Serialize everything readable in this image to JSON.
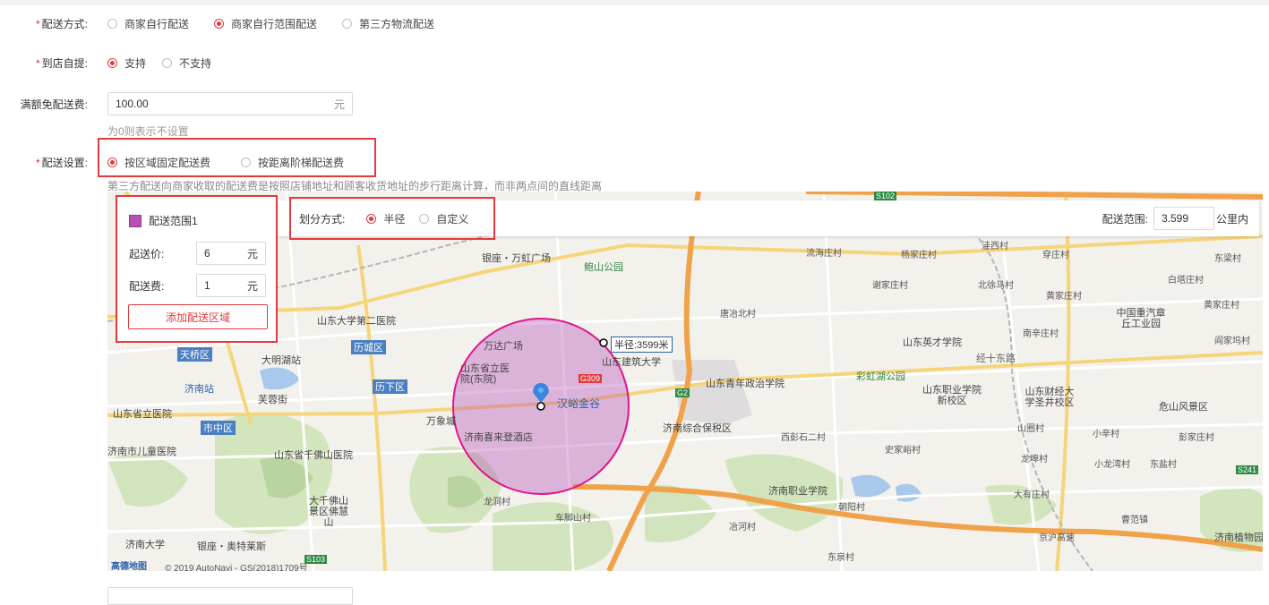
{
  "form": {
    "delivery_method": {
      "label": "配送方式:",
      "options": [
        "商家自行配送",
        "商家自行范围配送",
        "第三方物流配送"
      ],
      "selected": 1
    },
    "pickup": {
      "label": "到店自提:",
      "options": [
        "支持",
        "不支持"
      ],
      "selected": 0
    },
    "free_shipping": {
      "label": "满额免配送费:",
      "value": "100.00",
      "unit": "元",
      "hint": "为0则表示不设置"
    },
    "delivery_setting": {
      "label": "配送设置:",
      "options": [
        "按区域固定配送费",
        "按距离阶梯配送费"
      ],
      "selected": 0,
      "hint": "第三方配送向商家收取的配送费是按照店铺地址和顾客收货地址的步行距离计算，而非两点间的直线距离"
    }
  },
  "zone_panel": {
    "zone_name": "配送范围1",
    "zone_color": "#b84fb8",
    "min_price_label": "起送价:",
    "min_price_value": "6",
    "fee_label": "配送费:",
    "fee_value": "1",
    "unit": "元",
    "add_button": "添加配送区域"
  },
  "map_toolbar": {
    "division_label": "划分方式:",
    "division_options": [
      "半径",
      "自定义"
    ],
    "division_selected": 0,
    "range_label": "配送范围:",
    "range_value": "3.599",
    "range_unit": "公里内"
  },
  "map": {
    "radius_label": "半径:3599米",
    "center_label": "汉峪金谷",
    "attribution_logo": "高德地图",
    "attribution_text": "© 2019 AutoNavi - GS(2018)1709号",
    "circle_color": "#e0138c",
    "place_labels": [
      "银座・万虹广场",
      "鲍山公园",
      "山东大学第二医院",
      "万达广场",
      "大明湖站",
      "历城区",
      "天桥区",
      "济南站",
      "芙蓉街",
      "历下区",
      "山东省立医院",
      "山东省立医院(东院)",
      "万象城",
      "济南喜来登酒店",
      "市中区",
      "济南市儿童医院",
      "山东省千佛山医院",
      "大千佛山景区佛慧山",
      "济南大学",
      "银座・奥特莱斯",
      "龙洞村",
      "车脚山村",
      "山东建筑大学",
      "山东青年政治学院",
      "济南综合保税区",
      "唐冶北村",
      "山东英才学院",
      "彩虹湖公园",
      "山东职业学院新校区",
      "山东财经大学圣井校区",
      "中国重汽章丘工业园",
      "危山风景区",
      "济南职业学院",
      "济南植物园",
      "经十东路",
      "京沪高速",
      "西彭石二村",
      "冶河村",
      "朝阳村",
      "大有庄村",
      "曹范镇",
      "白塔庄村",
      "东梁村",
      "洼西村",
      "史家峪村",
      "东泉村",
      "谢家庄村",
      "流海庄村",
      "杨家庄村",
      "北徐马村",
      "黄家庄村",
      "南辛庄村",
      "山圈村",
      "小辛村",
      "龙埠村",
      "小龙湾村",
      "彭家庄村",
      "黄家庄村",
      "东盐村",
      "穿庄村",
      "阎家坞村"
    ],
    "road_badges": [
      "G309",
      "G2",
      "S102",
      "S103",
      "S241"
    ]
  }
}
